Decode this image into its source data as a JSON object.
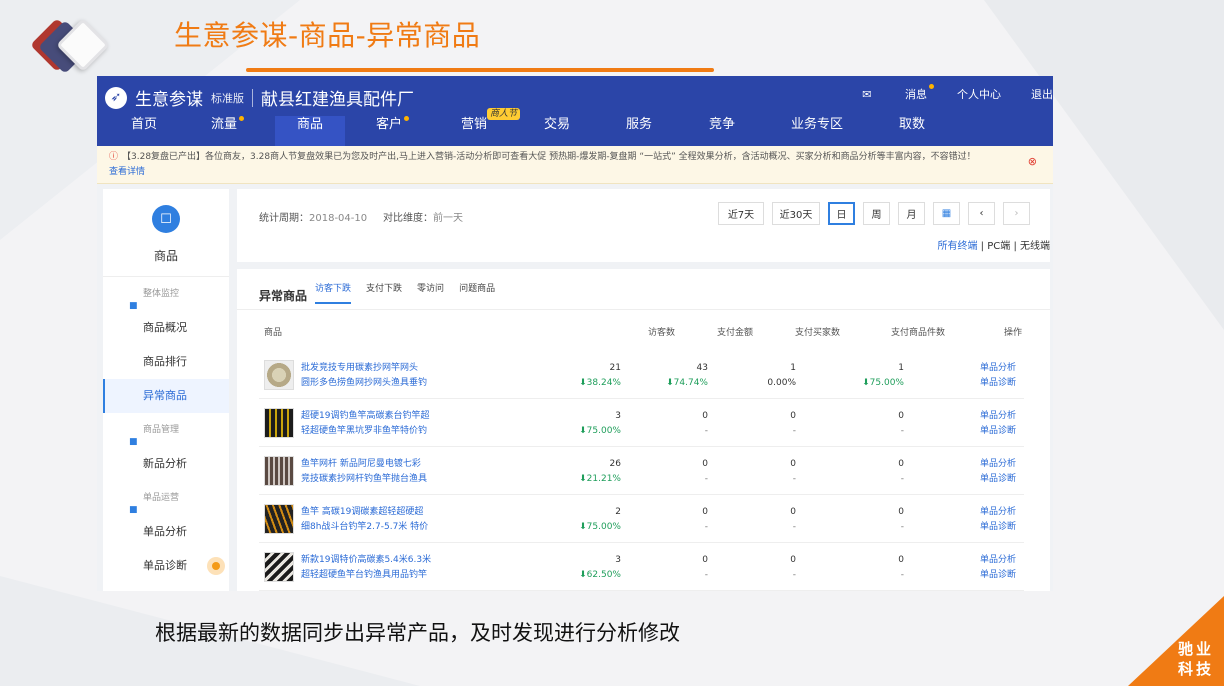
{
  "slide": {
    "title": "生意参谋-商品-异常商品",
    "caption": "根据最新的数据同步出异常产品，及时发现进行分析修改",
    "corner_brand": [
      "驰业",
      "科技"
    ],
    "accent_color": "#f07b14"
  },
  "app": {
    "brand_name": "生意参谋",
    "edition": "标准版",
    "shop_name": "献县红建渔具配件厂",
    "top_links": {
      "messages": "消息",
      "profile": "个人中心",
      "logout": "退出"
    },
    "nav": [
      {
        "label": "首页"
      },
      {
        "label": "流量"
      },
      {
        "label": "商品"
      },
      {
        "label": "客户"
      },
      {
        "label": "营销",
        "badge": "商人节"
      },
      {
        "label": "交易"
      },
      {
        "label": "服务"
      },
      {
        "label": "竞争"
      },
      {
        "label": "业务专区"
      },
      {
        "label": "取数"
      }
    ],
    "notice": {
      "text": "【3.28复盘已产出】各位商友，3.28商人节复盘效果已为您及时产出,马上进入营销-活动分析即可查看大促 预热期-爆发期-复盘期 “一站式” 全程效果分析，含活动概况、买家分析和商品分析等丰富内容，不容错过！",
      "link": "查看详情",
      "warn_icon": "warning-icon",
      "close_icon": "close-icon"
    },
    "sidebar": {
      "title": "商品",
      "groups": [
        {
          "label": "整体监控",
          "items": [
            "商品概况",
            "商品排行",
            "异常商品"
          ]
        },
        {
          "label": "商品管理",
          "items": [
            "新品分析"
          ]
        },
        {
          "label": "单品运营",
          "items": [
            "单品分析",
            "单品诊断"
          ]
        }
      ],
      "active_item": "异常商品",
      "primary_color": "#2f7fe0"
    },
    "period": {
      "label": "统计周期：",
      "date": "2018-04-10",
      "compare_label": "对比维度：",
      "compare_value": "前一天",
      "buttons": [
        "近7天",
        "近30天",
        "日",
        "周",
        "月"
      ],
      "active_button": "日",
      "prev_icon": "chevron-left-icon",
      "next_icon": "chevron-right-icon",
      "calendar_icon": "calendar-icon",
      "terminals": [
        "所有终端",
        "PC端",
        "无线端"
      ],
      "terminal_sep": "|"
    },
    "table": {
      "title": "异常商品",
      "tabs": [
        "访客下跌",
        "支付下跌",
        "零访问",
        "问题商品"
      ],
      "active_tab": "访客下跌",
      "columns": [
        "商品",
        "访客数",
        "支付金额",
        "支付买家数",
        "支付商品件数",
        "操作"
      ],
      "rows": [
        {
          "name": [
            "批发竞技专用碳素抄网竿网头",
            "圆形多色捞鱼网抄网头渔具垂钓"
          ],
          "visitors": "21",
          "visitors_chg": "38.24%",
          "amount": "43",
          "amount_chg": "74.74%",
          "buyers": "1",
          "buyers_chg": "0.00%",
          "qty": "1",
          "qty_chg": "75.00%"
        },
        {
          "name": [
            "超硬19调钓鱼竿高碳素台钓竿超",
            "轻超硬鱼竿黑坑罗非鱼竿特价钓"
          ],
          "visitors": "3",
          "visitors_chg": "75.00%",
          "amount": "0",
          "amount_chg": "-",
          "buyers": "0",
          "buyers_chg": "-",
          "qty": "0",
          "qty_chg": "-"
        },
        {
          "name": [
            "鱼竿网杆 新品阿尼曼电镀七彩",
            "竞技碳素抄网杆钓鱼竿抛台渔具"
          ],
          "visitors": "26",
          "visitors_chg": "21.21%",
          "amount": "0",
          "amount_chg": "-",
          "buyers": "0",
          "buyers_chg": "-",
          "qty": "0",
          "qty_chg": "-"
        },
        {
          "name": [
            "鱼竿 高碳19调碳素超轻超硬超",
            "细8h战斗台钓竿2.7-5.7米 特价"
          ],
          "visitors": "2",
          "visitors_chg": "75.00%",
          "amount": "0",
          "amount_chg": "-",
          "buyers": "0",
          "buyers_chg": "-",
          "qty": "0",
          "qty_chg": "-"
        },
        {
          "name": [
            "新款19调特价高碳素5.4米6.3米",
            "超轻超硬鱼竿台钓渔具用品钓竿"
          ],
          "visitors": "3",
          "visitors_chg": "62.50%",
          "amount": "0",
          "amount_chg": "-",
          "buyers": "0",
          "buyers_chg": "-",
          "qty": "0",
          "qty_chg": "-"
        }
      ],
      "ops": [
        "单品分析",
        "单品诊断"
      ],
      "down_color": "#1f9e5b",
      "down_icon": "arrow-down-icon"
    }
  }
}
